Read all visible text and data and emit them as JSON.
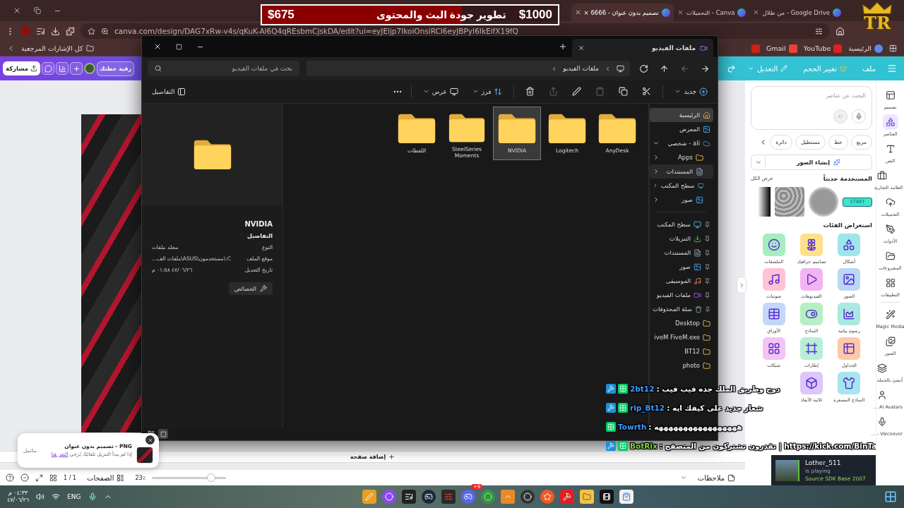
{
  "browser": {
    "tabs": [
      {
        "title": "Google Drive - من طلال",
        "selected": false
      },
      {
        "title": "Canva - التحميلات",
        "selected": false
      },
      {
        "title": "تصميم بدون عنوان - 6666 ×",
        "selected": true
      }
    ],
    "url": "canva.com/design/DAG7xRw-v4s/qKuK-Al6Q4qREsbmCjskDA/edit?ui=eyJEljp7IkoiOnsiRCI6eyJBPyI6IkEifX19fQ",
    "bookmarks": [
      {
        "label": "الرئيسية",
        "kind": "canva"
      },
      {
        "label": "YouTube",
        "kind": "youtube"
      },
      {
        "label": "Gmail",
        "kind": "gmail"
      }
    ],
    "all_bookmarks": "كل الإشارات المرجعية"
  },
  "canva": {
    "menu": [
      "ملف",
      "تغيير الحجم",
      "التعديل"
    ],
    "share_button": "مشاركة",
    "plan_button": "رقية خطتك",
    "rail": [
      {
        "label": "تصميم",
        "kind": "design",
        "selected": false
      },
      {
        "label": "العناصر",
        "kind": "elements",
        "selected": true
      },
      {
        "label": "النص",
        "kind": "text",
        "selected": false
      },
      {
        "label": "العلامة التجارية",
        "kind": "brand",
        "selected": false
      },
      {
        "label": "التحميلات",
        "kind": "uploads",
        "selected": false
      },
      {
        "label": "الأدوات",
        "kind": "tools",
        "selected": false
      },
      {
        "label": "المشروعات",
        "kind": "projects",
        "selected": false
      },
      {
        "label": "التطبيقات",
        "kind": "apps",
        "selected": false
      },
      {
        "label": "Magic Media",
        "kind": "magic",
        "selected": false
      },
      {
        "label": "الصور",
        "kind": "photos",
        "selected": false
      },
      {
        "label": "أنشئ بالجملة",
        "kind": "bulk",
        "selected": false
      },
      {
        "label": "AI Avatars ...",
        "kind": "avatar",
        "selected": false
      },
      {
        "label": "Voiceover - ...",
        "kind": "voice",
        "selected": false
      }
    ],
    "search_placeholder": "البحث عن عناصر",
    "shape_chips": [
      "مربع",
      "خط",
      "مستطيل",
      "دائرة"
    ],
    "generate_button": "إنشاء الصور",
    "recent_title": "المستخدمة حديثاً",
    "see_all": "عرض الكل",
    "recent_start": "START",
    "categories_title": "استعراض الفئات",
    "categories": [
      {
        "label": "أشكال",
        "kind": "shapes",
        "color": "#9fe6ea"
      },
      {
        "label": "تصاميم جرافيك",
        "kind": "graphics",
        "color": "#ffe08a"
      },
      {
        "label": "الملصقات",
        "kind": "stickers",
        "color": "#a8ecc2"
      },
      {
        "label": "الصور",
        "kind": "photos",
        "color": "#b9d8f5"
      },
      {
        "label": "الفيديوهات",
        "kind": "videos",
        "color": "#f2b5f0"
      },
      {
        "label": "صوتيات",
        "kind": "audio",
        "color": "#ffc2d4"
      },
      {
        "label": "رسوم بيانية",
        "kind": "charts",
        "color": "#a9e9e2"
      },
      {
        "label": "النماذج",
        "kind": "forms",
        "color": "#b4f0c4"
      },
      {
        "label": "الأوراق",
        "kind": "sheets",
        "color": "#c5d6fb"
      },
      {
        "label": "الجداول",
        "kind": "tables",
        "color": "#ffc9a8"
      },
      {
        "label": "إطارات",
        "kind": "frames",
        "color": "#b8efd8"
      },
      {
        "label": "شبكات",
        "kind": "grids",
        "color": "#f3c4f4"
      },
      {
        "label": "النماذج المصغرة",
        "kind": "mockups",
        "color": "#a6e7ee"
      },
      {
        "label": "ثلاثية الأبعاد",
        "kind": "cube",
        "color": "#dcc6fb"
      }
    ],
    "add_page": "إضافة صفحة",
    "notes": "ملاحظات",
    "zoom": "23٪",
    "pages": "الصفحات",
    "page_count": "1 / 1",
    "zoom_slider": {
      "level": 0.8
    }
  },
  "download_toast": {
    "title": "PNG - تصميم بدون عنوان",
    "status": "مكتمل",
    "message": "إذا لم يبدأ التنزيل تلقائيًا، يُرجى",
    "link": "النقر هنا"
  },
  "explorer": {
    "tab": "ملفات الفيديو",
    "breadcrumb": "ملفات الفيديو",
    "search_placeholder": "بحث في ملفات الفيديو",
    "nav_buttons": [
      {
        "kind": "back",
        "disabled": false
      },
      {
        "kind": "forward",
        "disabled": true
      },
      {
        "kind": "up",
        "disabled": false
      },
      {
        "kind": "refresh",
        "disabled": false
      }
    ],
    "new_button": "جديد",
    "tools": [
      {
        "kind": "cut",
        "disabled": false
      },
      {
        "kind": "copy",
        "disabled": false
      },
      {
        "kind": "paste",
        "disabled": true
      },
      {
        "kind": "rename",
        "disabled": false
      },
      {
        "kind": "share",
        "disabled": true
      },
      {
        "kind": "delete",
        "disabled": false
      }
    ],
    "sort_button": "فرز",
    "view_button": "عرض",
    "details_button": "التفاصيل",
    "nav": [
      {
        "label": "الرئيسية",
        "kind": "home",
        "selected": true
      },
      {
        "label": "المعرض",
        "kind": "gallery",
        "selected": false
      },
      {
        "label": "ali - شخصي",
        "kind": "cloud",
        "selected": false,
        "expanded": true,
        "children": [
          {
            "label": "Apps",
            "kind": "folder",
            "selected": false,
            "hovered": false,
            "expanded": false
          },
          {
            "label": "المستندات",
            "kind": "docs",
            "selected": false,
            "hovered": true,
            "expanded": false
          },
          {
            "label": "سطح المكتب",
            "kind": "desktop",
            "selected": false,
            "hovered": false,
            "expanded": false
          },
          {
            "label": "صور",
            "kind": "pictures",
            "selected": false,
            "hovered": false,
            "expanded": false
          }
        ]
      }
    ],
    "quick_access": [
      {
        "label": "سطح المكتب",
        "kind": "desktop",
        "pinned": true,
        "selected": false
      },
      {
        "label": "التنزيلات",
        "kind": "downloads",
        "pinned": true,
        "selected": false
      },
      {
        "label": "المستندات",
        "kind": "docs",
        "pinned": true,
        "selected": false
      },
      {
        "label": "صور",
        "kind": "pictures",
        "pinned": true,
        "selected": false
      },
      {
        "label": "الموسيقى",
        "kind": "music",
        "pinned": true,
        "selected": false
      },
      {
        "label": "ملفات الفيديو",
        "kind": "videos",
        "pinned": true,
        "selected": false
      },
      {
        "label": "سلة المحذوفات",
        "kind": "recycle",
        "pinned": true,
        "selected": false
      },
      {
        "label": "Desktop",
        "kind": "folder",
        "pinned": false,
        "selected": false
      },
      {
        "label": "iveM FiveM.exe",
        "kind": "folder",
        "pinned": false,
        "selected": false
      },
      {
        "label": "BT12",
        "kind": "folder",
        "pinned": false,
        "selected": false
      },
      {
        "label": "photo",
        "kind": "folder",
        "pinned": false,
        "selected": false
      }
    ],
    "folders": [
      {
        "name": "AnyDesk",
        "selected": false
      },
      {
        "name": "Logitech",
        "selected": false
      },
      {
        "name": "NVIDIA",
        "selected": true
      },
      {
        "name": "SteelSeries Moments",
        "selected": false
      },
      {
        "name": "اللقطات",
        "selected": false
      }
    ],
    "details": {
      "name": "NVIDIA",
      "heading": "التفاصيل",
      "rows": [
        {
          "label": "النوع",
          "value": "مجلد ملفات"
        },
        {
          "label": "موقع الملف",
          "value": "C:\\مستخدمون\\ASUS\\ملفات الف..."
        },
        {
          "label": "تاريخ التعديل",
          "value": "٤٧/٠٦/٢٦ ٠١:٥٨ م"
        }
      ],
      "button": "الخصائص"
    },
    "view_toggles": [
      {
        "kind": "tiles",
        "selected": true
      },
      {
        "kind": "list",
        "selected": false
      }
    ]
  },
  "taskbar": {
    "lang": "ENG",
    "time": "٠٤:٣٣ م",
    "date": "٤٧/٠٦/٢٦",
    "badge": "9+"
  },
  "stream": {
    "logo": "TR",
    "goal": {
      "title": "تطوير جودة البث والمحتوى",
      "raised": "$675",
      "target": "$1000",
      "level": 0.675
    },
    "chat": [
      {
        "user": "2bt12",
        "message": ": دوج وطريق الملك جده فيب فيب",
        "color": "#3d9bff",
        "mod": true
      },
      {
        "user": "rip_Bt12",
        "message": ": شعار جديد على كيفك ايه",
        "color": "#3d9bff",
        "mod": true
      },
      {
        "user": "Towrth",
        "message": ": هههههههههههههههههه",
        "color": "#3d9bff",
        "mod": false
      },
      {
        "user": "BotRix",
        "message": ": تقدرون تشتركون من المتصفح | https://kick.com/BinTa",
        "color": "#7fd63a",
        "mod": true
      }
    ],
    "steam": {
      "user": "Lother_511",
      "status": "is playing",
      "game": "Source SDK Base 2007"
    }
  }
}
